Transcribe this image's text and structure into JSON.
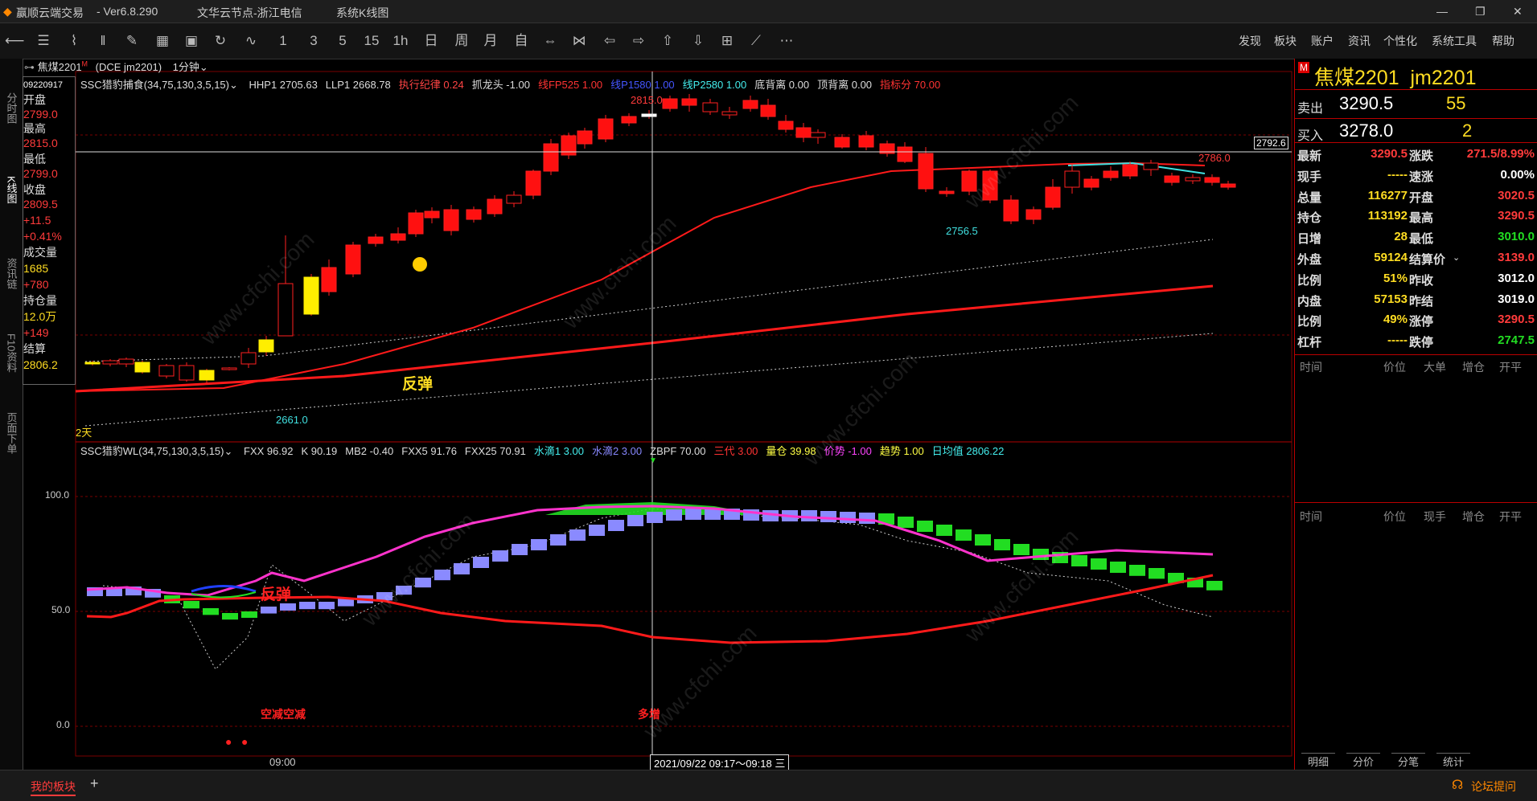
{
  "titlebar": {
    "app": "赢顺云端交易",
    "version": "- Ver6.8.290",
    "server": "文华云节点-浙江电信",
    "view": "系统K线图",
    "controls": [
      "—",
      "❐",
      "✕"
    ]
  },
  "toolbar": {
    "periods": [
      "1",
      "3",
      "5",
      "15",
      "1h",
      "日",
      "周",
      "月",
      "自"
    ],
    "menus": [
      "发现",
      "板块",
      "账户",
      "资讯",
      "个性化",
      "系统工具",
      "帮助"
    ],
    "more": "⋯"
  },
  "leftnav": [
    "分时图",
    "K线图",
    "资讯链",
    "F10资料",
    "页面下单"
  ],
  "chart_header": {
    "symbol": "焦煤2201",
    "symbol_mark": "M",
    "exchange": "(DCE  jm2201)",
    "period": "1分钟"
  },
  "ohlc_box": {
    "date": "09220917",
    "open_label": "开盘",
    "open": "2799.0",
    "high_label": "最高",
    "high": "2815.0",
    "low_label": "最低",
    "low": "2799.0",
    "close_label": "收盘",
    "close": "2809.5",
    "change": "+11.5",
    "change_pct": "+0.41%",
    "volume_label": "成交量",
    "volume": "1685",
    "volume_chg": "+780",
    "oi_label": "持仓量",
    "oi": "12.0万",
    "oi_chg": "+149",
    "settle_label": "结算",
    "settle": "2806.2"
  },
  "main_indicator": {
    "name": "SSC猎豹捕食(34,75,130,3,5,15)",
    "items": [
      {
        "text": "HHP1 2705.63",
        "color": "#dddddd"
      },
      {
        "text": "LLP1 2668.78",
        "color": "#dddddd"
      },
      {
        "text": "执行纪律 0.24",
        "color": "#ff4444"
      },
      {
        "text": "抓龙头 -1.00",
        "color": "#dddddd"
      },
      {
        "text": "线FP525 1.00",
        "color": "#ff3333"
      },
      {
        "text": "线P1580 1.00",
        "color": "#4455ff"
      },
      {
        "text": "线P2580 1.00",
        "color": "#44eeee"
      },
      {
        "text": "底背离 0.00",
        "color": "#dddddd"
      },
      {
        "text": "顶背离 0.00",
        "color": "#dddddd"
      },
      {
        "text": "指标分 70.00",
        "color": "#ff3333"
      }
    ]
  },
  "main_labels": {
    "peak": "2815.0",
    "right_high": "2786.0",
    "low_right": "2756.5",
    "low_left": "2661.0",
    "crosshair_price": "2792.6",
    "span": "2天",
    "signal": "反弹"
  },
  "sub_indicator": {
    "name": "SSC猎豹WL(34,75,130,3,5,15)",
    "items": [
      {
        "text": "FXX 96.92",
        "color": "#dddddd"
      },
      {
        "text": "K 90.19",
        "color": "#dddddd"
      },
      {
        "text": "MB2 -0.40",
        "color": "#dddddd"
      },
      {
        "text": "FXX5 91.76",
        "color": "#dddddd"
      },
      {
        "text": "FXX25 70.91",
        "color": "#dddddd"
      },
      {
        "text": "水滴1 3.00",
        "color": "#44eeee"
      },
      {
        "text": "水滴2 3.00",
        "color": "#8888ff"
      },
      {
        "text": "ZBPF 70.00",
        "color": "#dddddd"
      },
      {
        "text": "三代 3.00",
        "color": "#ff3333"
      },
      {
        "text": "量仓 39.98",
        "color": "#ffff44"
      },
      {
        "text": "价势 -1.00",
        "color": "#ff44ff"
      },
      {
        "text": "趋势 1.00",
        "color": "#ffff44"
      },
      {
        "text": "日均值 2806.22",
        "color": "#44eeee"
      }
    ],
    "y_ticks": [
      "100.0",
      "50.0",
      "0.0"
    ],
    "signal_left": "空减空减",
    "signal_right": "多增",
    "signal_rebound": "反弹"
  },
  "xaxis": {
    "time_label": "09:00",
    "cursor_label": "2021/09/22 09:17～09:18 三"
  },
  "quote_panel": {
    "marker": "M",
    "title": "焦煤2201  jm2201",
    "ask_label": "卖出",
    "ask": "3290.5",
    "ask_vol": "55",
    "bid_label": "买入",
    "bid": "3278.0",
    "bid_vol": "2",
    "rows": [
      {
        "l1": "最新",
        "v1": "3290.5",
        "c1": "#ff3b3b",
        "l2": "涨跌",
        "v2": "271.5/8.99%",
        "c2": "#ff3b3b"
      },
      {
        "l1": "现手",
        "v1": "-----",
        "c1": "#ffdd22",
        "l2": "速涨",
        "v2": "0.00%",
        "c2": "#ffffff"
      },
      {
        "l1": "总量",
        "v1": "116277",
        "c1": "#ffdd22",
        "l2": "开盘",
        "v2": "3020.5",
        "c2": "#ff3b3b"
      },
      {
        "l1": "持仓",
        "v1": "113192",
        "c1": "#ffdd22",
        "l2": "最高",
        "v2": "3290.5",
        "c2": "#ff3b3b"
      },
      {
        "l1": "日增",
        "v1": "28",
        "c1": "#ffdd22",
        "l2": "最低",
        "v2": "3010.0",
        "c2": "#22dd22"
      },
      {
        "l1": "外盘",
        "v1": "59124",
        "c1": "#ffdd22",
        "l2": "结算价",
        "v2": "3139.0",
        "c2": "#ff3b3b"
      },
      {
        "l1": "比例",
        "v1": "51%",
        "c1": "#ffdd22",
        "l2": "昨收",
        "v2": "3012.0",
        "c2": "#ffffff"
      },
      {
        "l1": "内盘",
        "v1": "57153",
        "c1": "#ffdd22",
        "l2": "昨结",
        "v2": "3019.0",
        "c2": "#ffffff"
      },
      {
        "l1": "比例",
        "v1": "49%",
        "c1": "#ffdd22",
        "l2": "涨停",
        "v2": "3290.5",
        "c2": "#ff3b3b"
      },
      {
        "l1": "杠杆",
        "v1": "-----",
        "c1": "#ffdd22",
        "l2": "跌停",
        "v2": "2747.5",
        "c2": "#22dd22"
      }
    ],
    "table1_headers": [
      "时间",
      "价位",
      "大单",
      "增仓",
      "开平"
    ],
    "table2_headers": [
      "时间",
      "价位",
      "现手",
      "增仓",
      "开平"
    ],
    "tabs": [
      "明细",
      "分价",
      "分笔",
      "统计"
    ]
  },
  "statusbar": {
    "tab": "我的板块",
    "add": "+",
    "forum": "论坛提问"
  },
  "watermark": "www.cfchi.com",
  "colors": {
    "up": "#ff2020",
    "down": "#00dd00",
    "ma_red": "#ff1a1a",
    "cyan": "#40e0e0",
    "purple": "#8a8aff",
    "magenta": "#ff33cc",
    "yellow": "#ffee00"
  }
}
